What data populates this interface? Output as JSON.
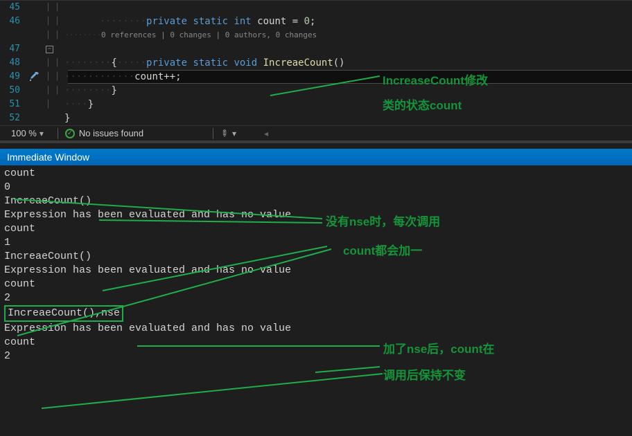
{
  "editor": {
    "lines": {
      "l45": {
        "num": "45",
        "indent_dots": "········",
        "code_pre": "private static int",
        "code_mid": " count",
        "code_assign": " = ",
        "code_val": "0",
        "code_end": ";"
      },
      "l46": {
        "num": "46"
      },
      "codelens": "0 references | 0 changes | 0 authors, 0 changes",
      "l47": {
        "num": "47",
        "indent_dots": "········",
        "code_pre": "private static void",
        "code_method": " IncreaeCount",
        "code_tail": "()"
      },
      "l48": {
        "num": "48",
        "indent_dots": "········",
        "brace": "{"
      },
      "l49": {
        "num": "49",
        "indent_dots": "············",
        "expr": "count++",
        "semi": ";"
      },
      "l50": {
        "num": "50",
        "indent_dots": "········",
        "brace": "}"
      },
      "l51": {
        "num": "51",
        "indent_dots": "····",
        "brace": "}"
      },
      "l52": {
        "num": "52",
        "brace": "}"
      }
    }
  },
  "status": {
    "zoom": "100 %",
    "issues": "No issues found"
  },
  "immediate": {
    "title": "Immediate Window",
    "lines": [
      "count",
      "0",
      "IncreaeCount()",
      "Expression has been evaluated and has no value",
      "count",
      "1",
      "IncreaeCount()",
      "Expression has been evaluated and has no value",
      "count",
      "2",
      "IncreaeCount(),nse",
      "Expression has been evaluated and has no value",
      "count",
      "2"
    ]
  },
  "annotations": {
    "a1_line1": "IncreaseCount修改",
    "a1_line2": "类的状态count",
    "a2_line1": "没有nse时，每次调用",
    "a2_line2": "count都会加一",
    "a3_line1": "加了nse后，count在",
    "a3_line2": "调用后保持不变"
  }
}
